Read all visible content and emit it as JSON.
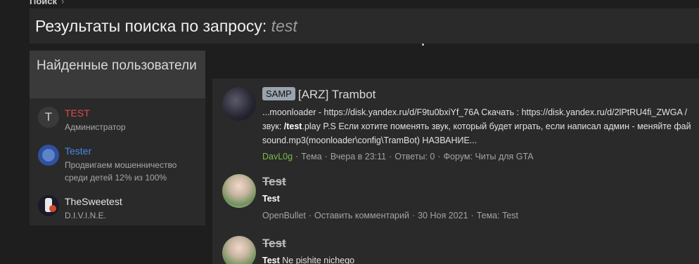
{
  "breadcrumb": {
    "label": "Поиск",
    "chevron": "›"
  },
  "title": {
    "prefix": "Результаты поиска по запросу:",
    "query": "test"
  },
  "sidebar": {
    "header": "Найденные пользователи",
    "users": [
      {
        "name": "TEST",
        "sub": "Администратор",
        "avatar_letter": "T",
        "color": "#e0474d"
      },
      {
        "name": "Tester",
        "sub": "Продвигаем мошенничество среди детей 12% из 100%",
        "color": "#4a86e8"
      },
      {
        "name": "TheSweetest",
        "sub": "D.I.V.I.N.E.",
        "color": "#e8e8e8"
      }
    ]
  },
  "results": [
    {
      "prefix": "SAMP",
      "title": "[ARZ] Trambot",
      "snippet": [
        "...moonloader - https://disk.yandex.ru/d/F9tu0bxiYf_76A Скачать : https://disk.yandex.ru/d/2lPtRU4fi_ZWGA /",
        {
          "before": "звук: ",
          "bold": "/test",
          "after": ".play P.S Если хотите поменять звук, который будет играть, если написал админ - меняйте фай"
        },
        "sound.mp3(moonloader\\config\\TramBot) НАЗВАНИЕ..."
      ],
      "meta": {
        "author": "DavL0g",
        "type": "Тема",
        "date": "Вчера в 23:11",
        "replies": "Ответы: 0",
        "forum": "Форум: Читы для GTA"
      }
    },
    {
      "title": "Test",
      "bold": "Test",
      "tail": "",
      "meta": {
        "author": "OpenBullet",
        "action": "Оставить комментарий",
        "date": "30 Ноя 2021",
        "thread": "Тема: Test"
      }
    },
    {
      "title": "Test",
      "bold": "Test",
      "tail": " Ne pishite nichego"
    }
  ],
  "colors": {
    "accent_green": "#7cba4a",
    "accent_red": "#e0474d",
    "accent_blue": "#4a86e8"
  }
}
